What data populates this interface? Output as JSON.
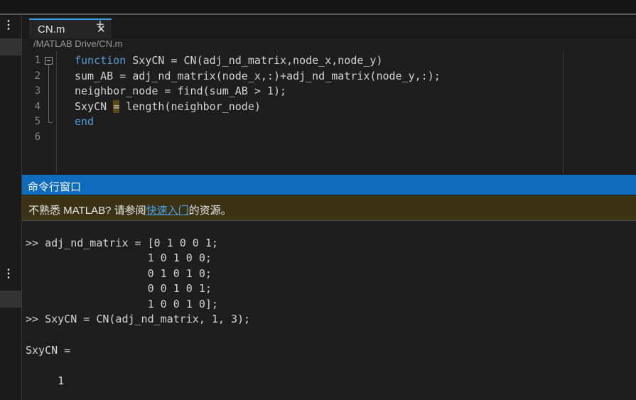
{
  "editor": {
    "tab_label": "CN.m",
    "close_glyph": "✕",
    "add_glyph": "+",
    "file_path": "/MATLAB Drive/CN.m",
    "line_numbers": [
      "1",
      "2",
      "3",
      "4",
      "5",
      "6"
    ],
    "lines": {
      "l1_kw": "function",
      "l1_rest": " SxyCN = CN(adj_nd_matrix,node_x,node_y)",
      "l2": "sum_AB = adj_nd_matrix(node_x,:)+adj_nd_matrix(node_y,:);",
      "l3": "neighbor_node = find(sum_AB > 1);",
      "l4_a": "SxyCN ",
      "l4_eq": "=",
      "l4_b": " length(neighbor_node)",
      "l5_kw": "end"
    }
  },
  "command_window": {
    "title": "命令行窗口",
    "banner_prefix": "不熟悉 MATLAB? 请参阅",
    "banner_link": "快速入门",
    "banner_suffix": "的资源。",
    "output": [
      ">> adj_nd_matrix = [0 1 0 0 1;",
      "                   1 0 1 0 0;",
      "                   0 1 0 1 0;",
      "                   0 0 1 0 1;",
      "                   1 0 0 1 0];",
      ">> SxyCN = CN(adj_nd_matrix, 1, 3);",
      "",
      "SxyCN =",
      "",
      "     1"
    ]
  },
  "sidebar": {
    "menu_glyph": "⋮"
  },
  "icons": {
    "fold": "collapse-box-icon"
  },
  "colors": {
    "accent": "#0f6cbd",
    "keyword": "#569cd6",
    "link": "#4aa3e8",
    "banner_bg": "#3c3317"
  }
}
